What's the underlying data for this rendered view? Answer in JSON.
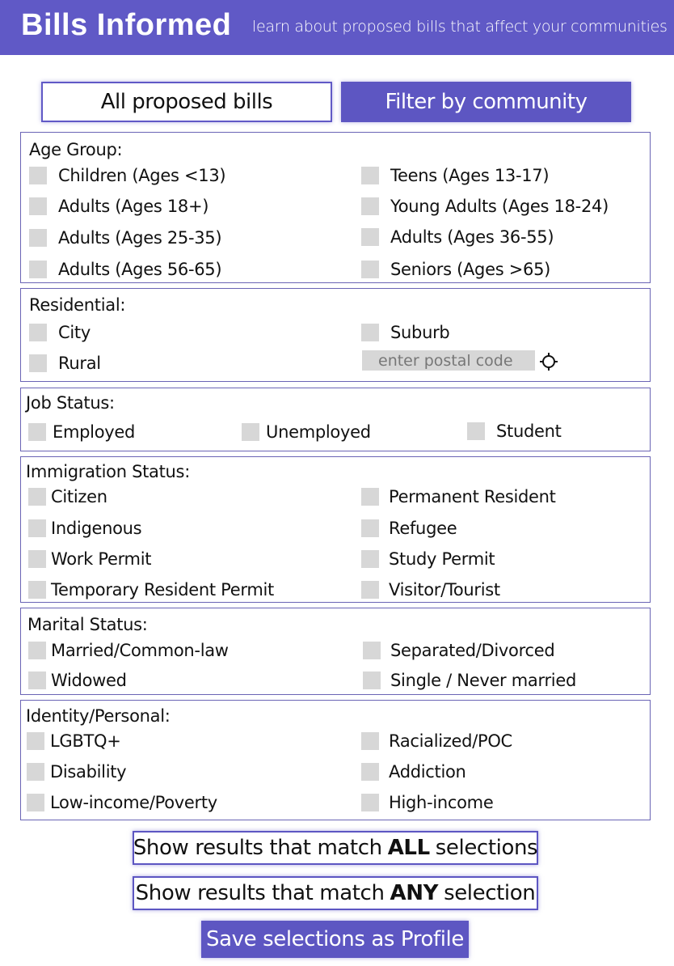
{
  "header": {
    "title": "Bills Informed",
    "tagline": "learn about proposed bills that affect your communities"
  },
  "tabs": {
    "all": "All proposed bills",
    "filter": "Filter by community"
  },
  "sections": {
    "age": {
      "title": "Age Group:",
      "options": [
        "Children (Ages <13)",
        "Teens (Ages 13-17)",
        "Adults (Ages 18+)",
        "Young Adults (Ages 18-24)",
        "Adults (Ages 25-35)",
        "Adults (Ages 36-55)",
        "Adults (Ages 56-65)",
        "Seniors (Ages >65)"
      ]
    },
    "residential": {
      "title": "Residential:",
      "options": [
        "City",
        "Suburb",
        "Rural"
      ],
      "postal_placeholder": "enter postal code"
    },
    "job": {
      "title": "Job Status:",
      "options": [
        "Employed",
        "Unemployed",
        "Student"
      ]
    },
    "immigration": {
      "title": "Immigration Status:",
      "options": [
        "Citizen",
        "Permanent Resident",
        "Indigenous",
        "Refugee",
        "Work Permit",
        "Study Permit",
        "Temporary Resident Permit",
        "Visitor/Tourist"
      ]
    },
    "marital": {
      "title": "Marital Status:",
      "options": [
        "Married/Common-law",
        "Separated/Divorced",
        "Widowed",
        "Single / Never married"
      ]
    },
    "identity": {
      "title": "Identity/Personal:",
      "options": [
        "LGBTQ+",
        "Racialized/POC",
        "Disability",
        "Addiction",
        "Low-income/Poverty",
        "High-income"
      ]
    }
  },
  "actions": {
    "match_all": {
      "prefix": "Show results that match",
      "keyword": "ALL",
      "suffix": "selections"
    },
    "match_any": {
      "prefix": "Show results that match",
      "keyword": "ANY",
      "suffix": "selection"
    },
    "save": "Save selections as Profile"
  },
  "colors": {
    "brand": "#6059c6",
    "checkbox": "#d7d7d7"
  },
  "icons": {
    "location": "crosshair-location-icon"
  }
}
